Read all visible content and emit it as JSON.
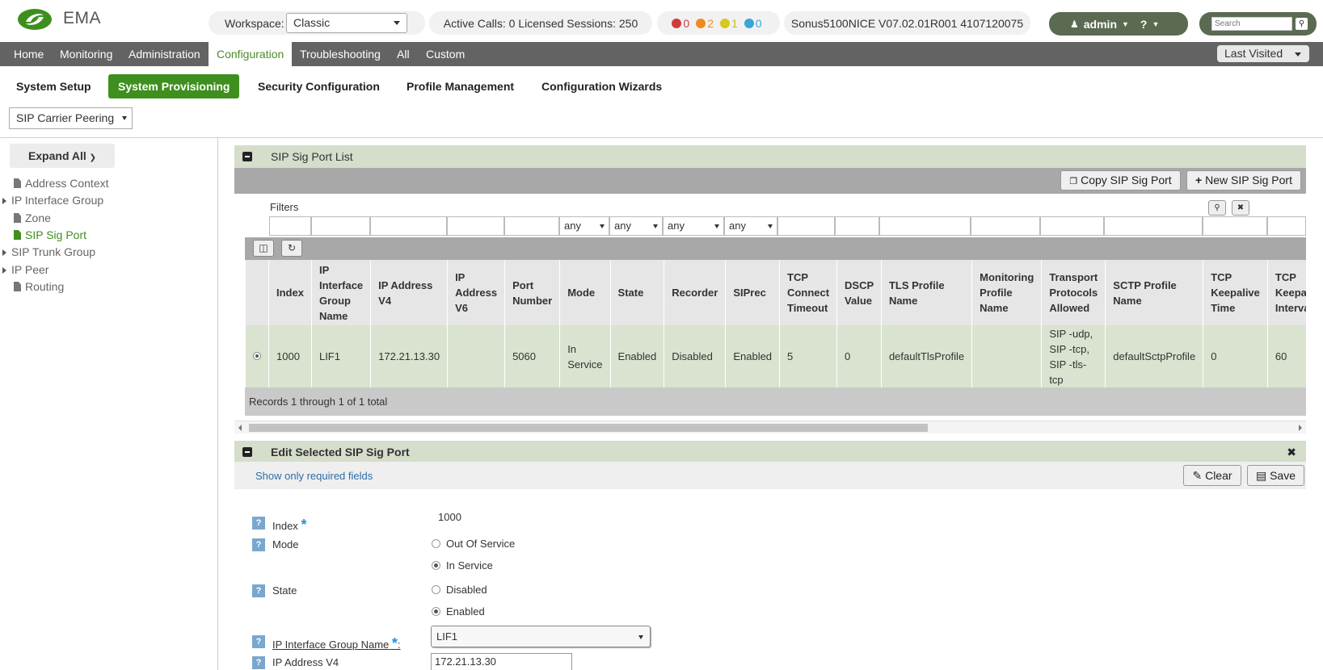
{
  "header": {
    "app_name": "EMA",
    "workspace_label": "Workspace:",
    "workspace_value": "Classic",
    "calls_status": "Active Calls: 0 Licensed Sessions: 250",
    "alarms": [
      {
        "color": "#d23b3b",
        "count": "0"
      },
      {
        "color": "#f08a1e",
        "count": "2"
      },
      {
        "color": "#d6c81c",
        "count": "1"
      },
      {
        "color": "#3aa5d8",
        "count": "0"
      }
    ],
    "system_info": "Sonus5100NICE V07.02.01R001 4107120075",
    "user": "admin",
    "help_label": "?",
    "search_placeholder": "Search"
  },
  "main_nav": {
    "items": [
      "Home",
      "Monitoring",
      "Administration",
      "Configuration",
      "Troubleshooting",
      "All",
      "Custom"
    ],
    "last_visited": "Last Visited"
  },
  "sub_nav": {
    "items": [
      "System Setup",
      "System Provisioning",
      "Security Configuration",
      "Profile Management",
      "Configuration Wizards"
    ]
  },
  "context_select": "SIP Carrier Peering",
  "sidebar": {
    "expand_all": "Expand All",
    "items": [
      "Address Context",
      "IP Interface Group",
      "Zone",
      "SIP Sig Port",
      "SIP Trunk Group",
      "IP Peer",
      "Routing"
    ]
  },
  "list_panel": {
    "title": "SIP Sig Port List",
    "copy_button": "Copy SIP Sig Port",
    "new_button": "New SIP Sig Port",
    "filters_label": "Filters",
    "filter_any": "any",
    "columns": [
      "Index",
      "IP Interface Group Name",
      "IP Address V4",
      "IP Address V6",
      "Port Number",
      "Mode",
      "State",
      "Recorder",
      "SIPrec",
      "TCP Connect Timeout",
      "DSCP Value",
      "TLS Profile Name",
      "Monitoring Profile Name",
      "Transport Protocols Allowed",
      "SCTP Profile Name",
      "TCP Keepalive Time",
      "TCP Keepalive Interval"
    ],
    "row": [
      "1000",
      "LIF1",
      "172.21.13.30",
      "",
      "5060",
      "In Service",
      "Enabled",
      "Disabled",
      "Enabled",
      "5",
      "0",
      "defaultTlsProfile",
      "",
      "SIP -udp, SIP -tcp, SIP -tls-tcp",
      "defaultSctpProfile",
      "0",
      "60"
    ],
    "records": "Records 1 through 1 of 1 total"
  },
  "edit_panel": {
    "title": "Edit Selected SIP Sig Port",
    "show_required": "Show only required fields",
    "clear_button": "Clear",
    "save_button": "Save",
    "index_label": "Index",
    "index_value": "1000",
    "mode_label": "Mode",
    "mode_options": [
      "Out Of Service",
      "In Service"
    ],
    "state_label": "State",
    "state_options": [
      "Disabled",
      "Enabled"
    ],
    "ip_group_label": "IP Interface Group Name",
    "ip_group_value": "LIF1",
    "ip_v4_label": "IP Address V4",
    "ip_v4_value": "172.21.13.30"
  }
}
